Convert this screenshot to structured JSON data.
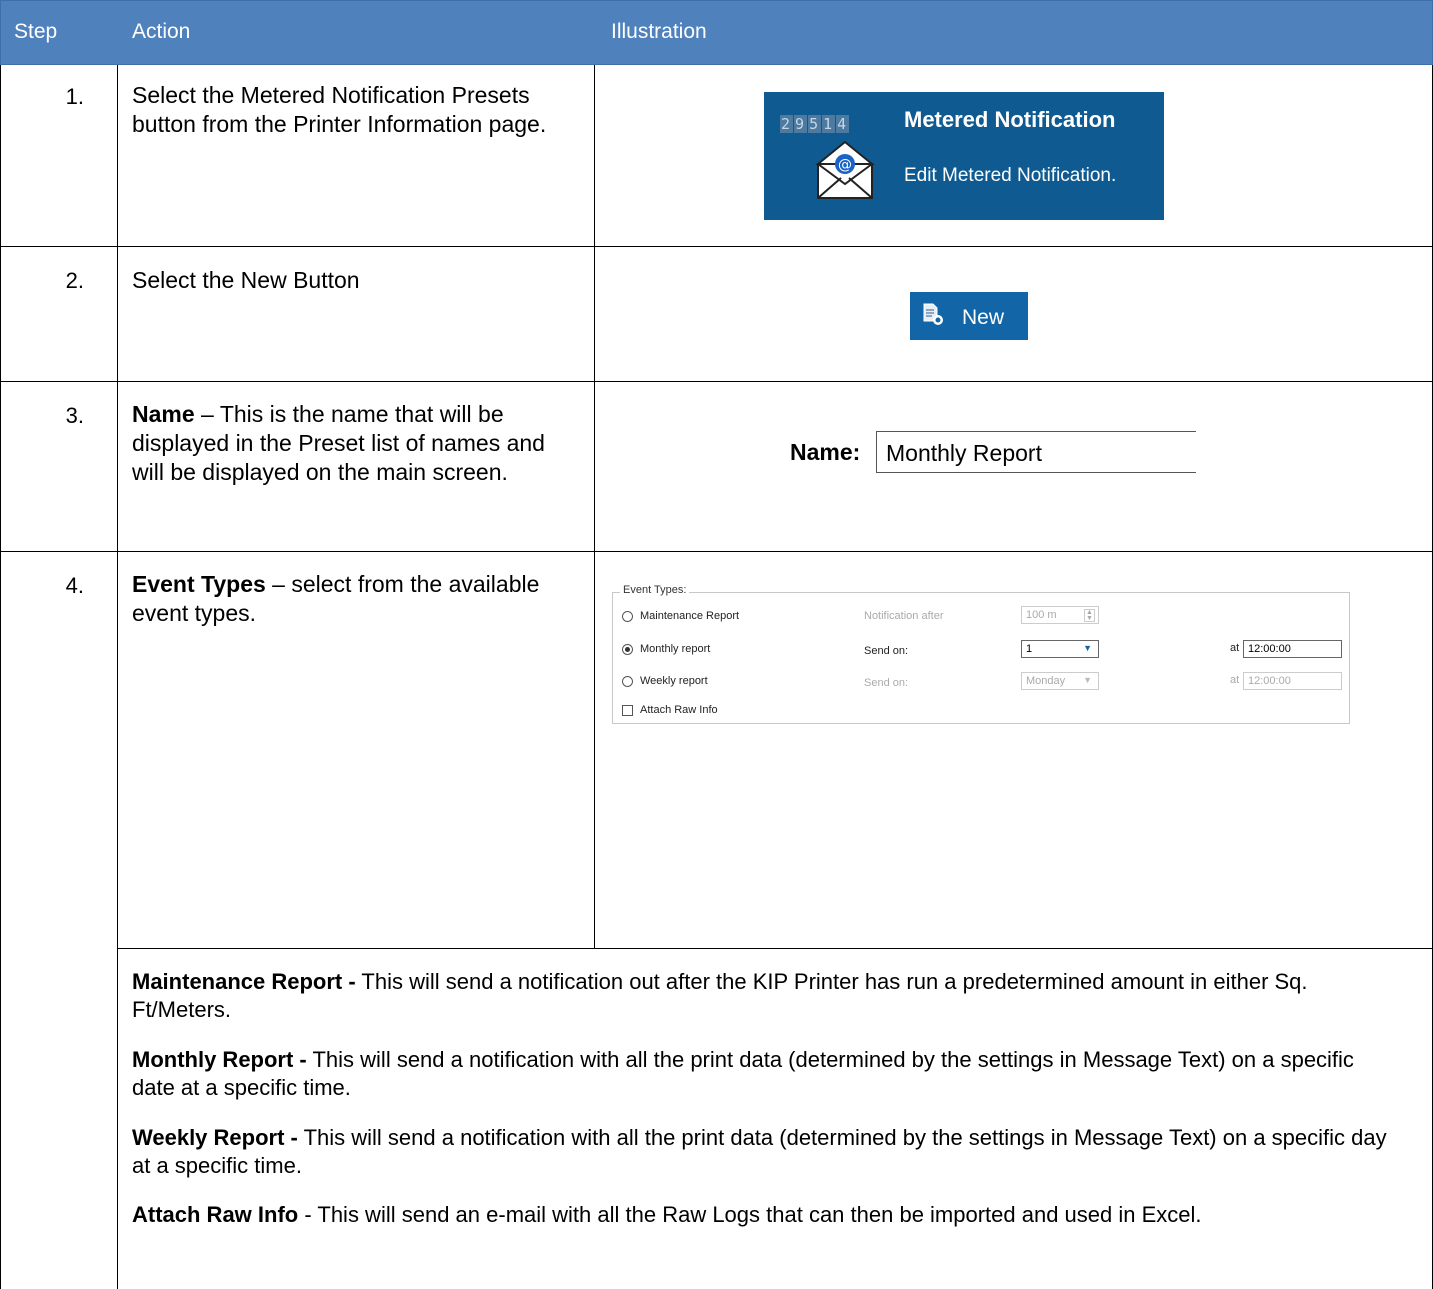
{
  "header": {
    "step": "Step",
    "action": "Action",
    "illustration": "Illustration"
  },
  "rows": [
    {
      "num": "1.",
      "text": "Select the Metered Notification Presets button from the Printer Information page."
    },
    {
      "num": "2.",
      "text": "Select the New Button"
    },
    {
      "num": "3.",
      "bold": "Name",
      "text": " – This is the name that will be displayed in the Preset list of names and will be displayed on the main screen."
    },
    {
      "num": "4.",
      "bold": "Event Types",
      "text": " – select from the available event types."
    }
  ],
  "metered_button": {
    "digits": [
      "2",
      "9",
      "5",
      "1",
      "4"
    ],
    "title": "Metered Notification",
    "subtitle": "Edit Metered Notification.",
    "icon": "envelope-at-icon",
    "bg_color": "#0f5b91"
  },
  "new_button": {
    "label": "New",
    "icon": "new-document-icon",
    "bg_color": "#1266a7"
  },
  "name_field": {
    "label": "Name:",
    "value": "Monthly Report"
  },
  "event_types": {
    "legend": "Event Types:",
    "maintenance": {
      "label": "Maintenance Report",
      "notify_label": "Notification after",
      "value": "100 m"
    },
    "monthly": {
      "label": "Monthly report",
      "send_label": "Send on:",
      "value": "1",
      "at_label": "at",
      "time": "12:00:00"
    },
    "weekly": {
      "label": "Weekly report",
      "send_label": "Send on:",
      "value": "Monday",
      "at_label": "at",
      "time": "12:00:00"
    },
    "attach": {
      "label": "Attach Raw Info"
    }
  },
  "descriptions": [
    {
      "bold": "Maintenance Report -",
      "text": " This will send a notification out after the KIP Printer has run a predetermined amount in either Sq. Ft/Meters."
    },
    {
      "bold": "Monthly Report -",
      "text": " This will send a notification with all the print data (determined by the settings in Message Text) on a specific date at a specific time."
    },
    {
      "bold": "Weekly Report -",
      "text": " This will send a notification with all the print data (determined by the settings in Message Text) on a specific day at a specific time."
    },
    {
      "bold": "Attach Raw Info",
      "text": " - This will send an e-mail with all the Raw Logs that can then be imported and used in Excel."
    }
  ]
}
